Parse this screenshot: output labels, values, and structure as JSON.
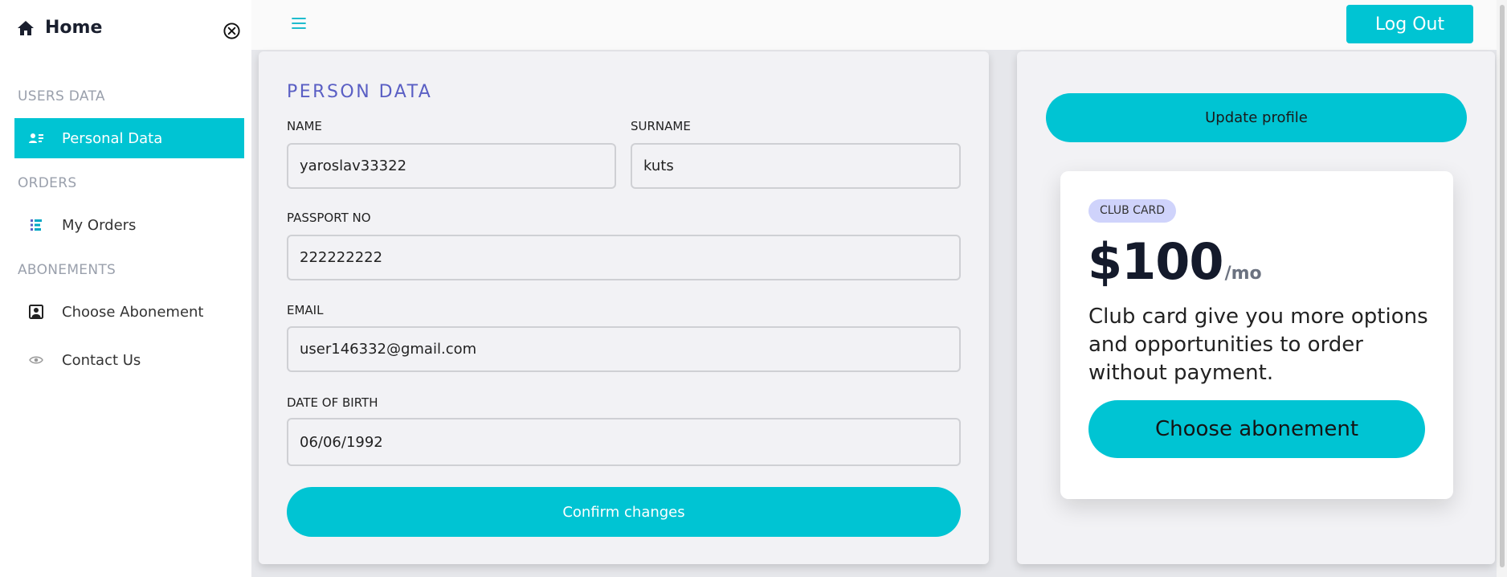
{
  "sidebar": {
    "home_label": "Home",
    "sections": [
      {
        "title": "USERS DATA"
      },
      {
        "title": "ORDERS"
      },
      {
        "title": "ABONEMENTS"
      }
    ],
    "items": [
      {
        "label": "Personal Data",
        "icon": "id-card-icon",
        "active": true
      },
      {
        "label": "My Orders",
        "icon": "list-icon",
        "active": false
      },
      {
        "label": "Choose Abonement",
        "icon": "portrait-icon",
        "active": false
      },
      {
        "label": "Contact Us",
        "icon": "eye-icon",
        "active": false
      }
    ]
  },
  "topbar": {
    "logout_label": "Log Out"
  },
  "person": {
    "title": "PERSON DATA",
    "name_label": "NAME",
    "name_value": "yaroslav33322",
    "surname_label": "SURNAME",
    "surname_value": "kuts",
    "passport_label": "PASSPORT NO",
    "passport_value": "222222222",
    "email_label": "EMAIL",
    "email_value": "user146332@gmail.com",
    "dob_label": "DATE OF BIRTH",
    "dob_value": "06/06/1992",
    "confirm_label": "Confirm changes"
  },
  "profile": {
    "update_label": "Update profile",
    "club_badge": "CLUB CARD",
    "club_price": "$100",
    "club_period": "/mo",
    "club_desc": "Club card give you more options and opportunities to order without payment.",
    "choose_label": "Choose abonement"
  },
  "colors": {
    "accent": "#00c4d3",
    "title": "#5a5fc4",
    "badge": "#cfd3fb"
  }
}
